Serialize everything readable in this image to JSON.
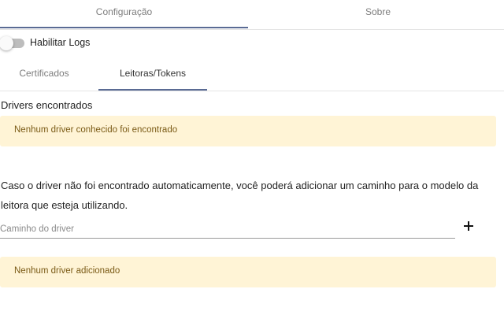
{
  "tabs": {
    "items": [
      {
        "label": "Configuração",
        "active": true
      },
      {
        "label": "Sobre",
        "active": false
      }
    ]
  },
  "logs": {
    "label": "Habilitar Logs",
    "enabled": false
  },
  "subtabs": {
    "items": [
      {
        "label": "Certificados",
        "active": false
      },
      {
        "label": "Leitoras/Tokens",
        "active": true
      }
    ]
  },
  "drivers": {
    "title": "Drivers encontrados",
    "empty_message": "Nenhum driver conhecido foi encontrado"
  },
  "info_text": "Caso o driver não foi encontrado automaticamente, você poderá adicionar um caminho para o modelo da leitora que esteja utilizando.",
  "path_input": {
    "placeholder": "Caminho do driver",
    "value": ""
  },
  "add_button": {
    "icon": "plus-icon"
  },
  "added": {
    "empty_message": "Nenhum driver adicionado"
  },
  "colors": {
    "accent": "#5a6b94",
    "alert_bg": "#fff4d6",
    "alert_text": "#7a5a15"
  }
}
